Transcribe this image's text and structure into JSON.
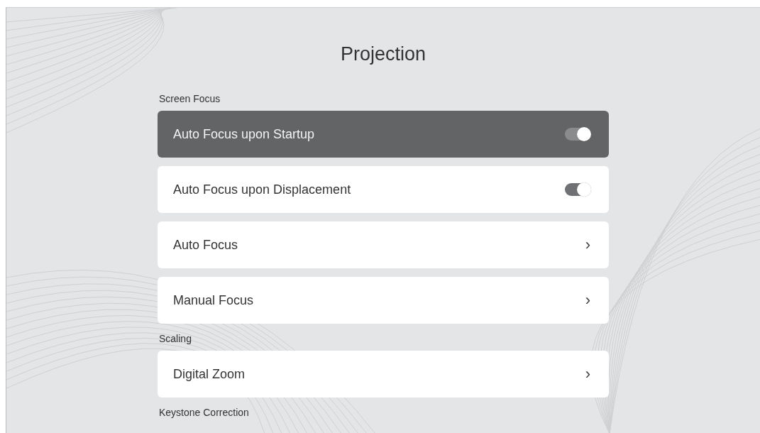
{
  "title": "Projection",
  "sections": [
    {
      "header": "Screen Focus",
      "items": [
        {
          "label": "Auto Focus upon Startup",
          "kind": "toggle",
          "on": true,
          "selected": true
        },
        {
          "label": "Auto Focus upon Displacement",
          "kind": "toggle",
          "on": true,
          "selected": false
        },
        {
          "label": "Auto Focus",
          "kind": "link",
          "chevron": "›",
          "selected": false
        },
        {
          "label": "Manual Focus",
          "kind": "link",
          "chevron": "›",
          "selected": false
        }
      ]
    },
    {
      "header": "Scaling",
      "items": [
        {
          "label": "Digital Zoom",
          "kind": "link",
          "chevron": "›",
          "selected": false
        }
      ]
    },
    {
      "header": "Keystone Correction"
    }
  ]
}
